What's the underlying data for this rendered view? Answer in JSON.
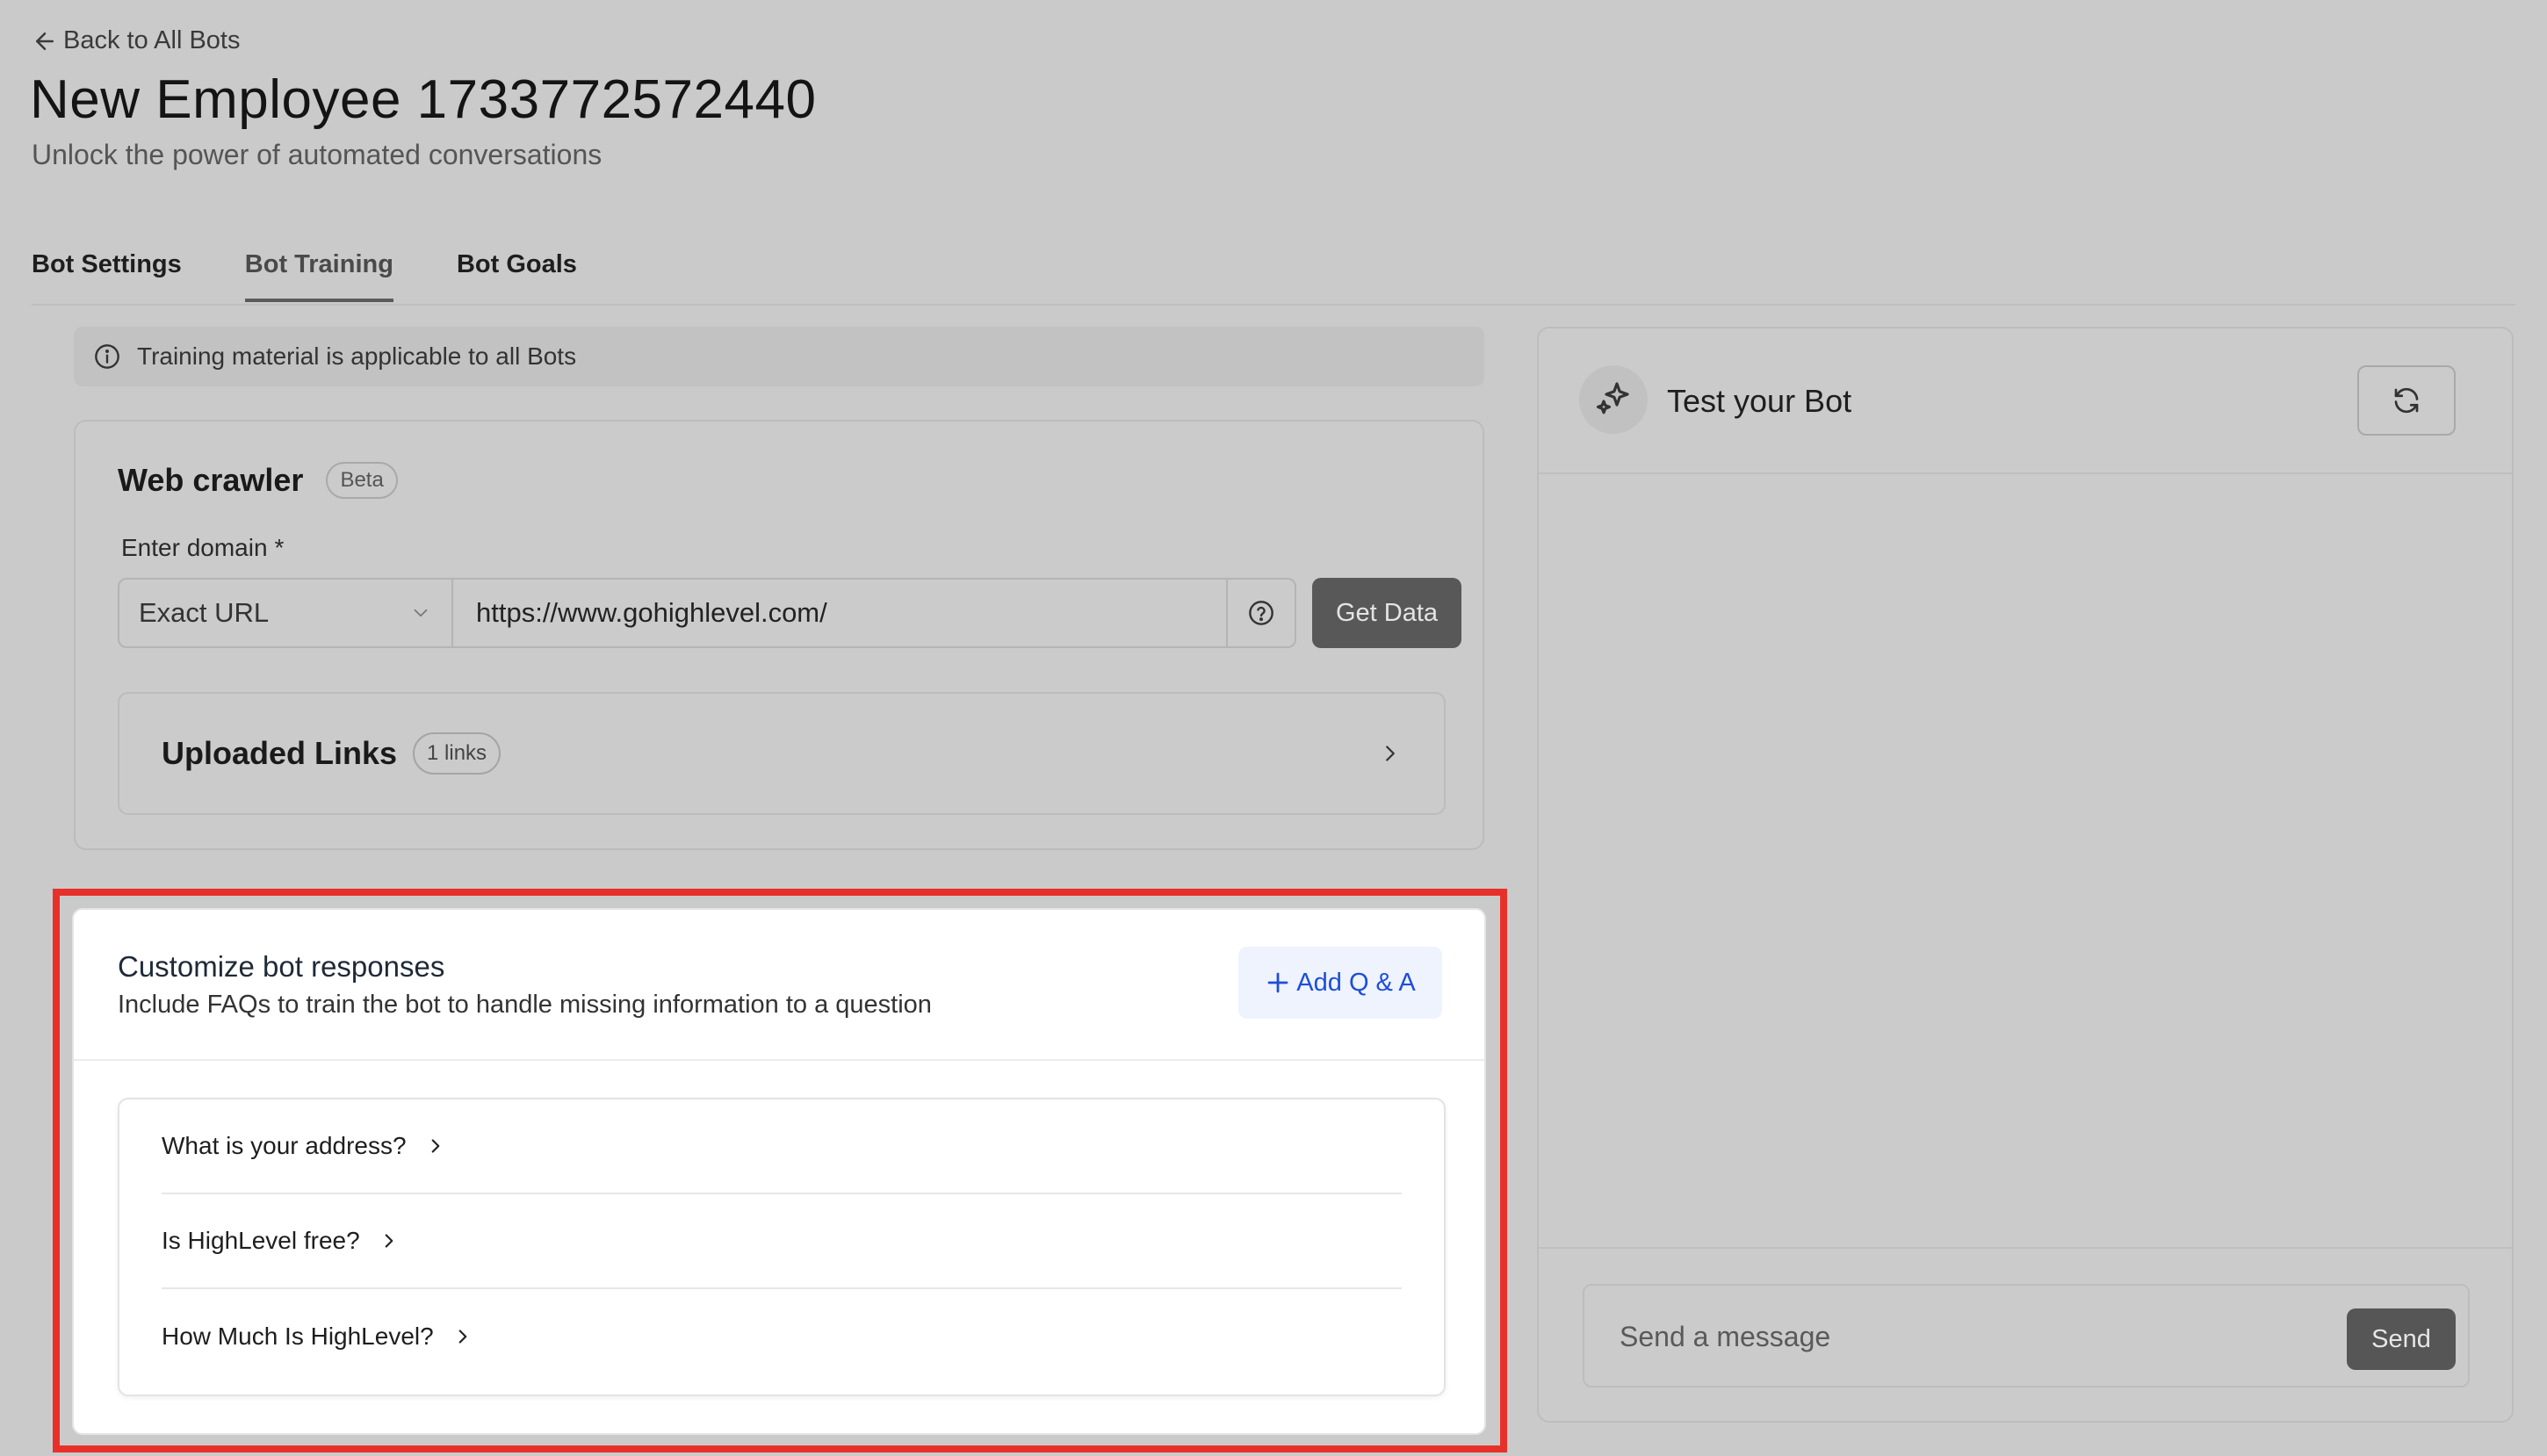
{
  "header": {
    "back_label": "Back to All Bots",
    "title": "New Employee 1733772572440",
    "subtitle": "Unlock the power of automated conversations"
  },
  "tabs": [
    {
      "label": "Bot Settings",
      "active": false
    },
    {
      "label": "Bot Training",
      "active": true
    },
    {
      "label": "Bot Goals",
      "active": false
    }
  ],
  "info_banner": {
    "icon": "info-icon",
    "text": "Training material is applicable to all Bots"
  },
  "web_crawler": {
    "title": "Web crawler",
    "badge": "Beta",
    "domain_label": "Enter domain",
    "required_mark": "*",
    "url_type": "Exact URL",
    "url_value": "https://www.gohighlevel.com/",
    "get_data_label": "Get Data",
    "uploaded_links": {
      "title": "Uploaded Links",
      "count_badge": "1 links"
    }
  },
  "customize": {
    "title": "Customize bot responses",
    "description": "Include FAQs to train the bot to handle missing information to a question",
    "add_label": "Add Q & A",
    "faqs": [
      {
        "question": "What is your address?"
      },
      {
        "question": "Is HighLevel free?"
      },
      {
        "question": "How Much Is HighLevel?"
      }
    ]
  },
  "test_panel": {
    "title": "Test your Bot",
    "message_placeholder": "Send a message",
    "send_label": "Send"
  },
  "colors": {
    "highlight_border": "#e8302a",
    "accent_blue": "#1d4ed8",
    "add_button_bg": "#eef3fe",
    "overlay_bg": "#cacaca"
  }
}
